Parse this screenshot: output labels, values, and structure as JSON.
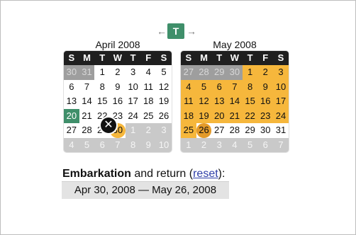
{
  "nav": {
    "left_arrow": "←",
    "today": "T",
    "right_arrow": "→"
  },
  "calendars": [
    {
      "month": "April 2008",
      "weekdays": [
        "S",
        "M",
        "T",
        "W",
        "T",
        "F",
        "S"
      ],
      "weeks": [
        [
          "30",
          "31",
          "1",
          "2",
          "3",
          "4",
          "5"
        ],
        [
          "6",
          "7",
          "8",
          "9",
          "10",
          "11",
          "12"
        ],
        [
          "13",
          "14",
          "15",
          "16",
          "17",
          "18",
          "19"
        ],
        [
          "20",
          "21",
          "22",
          "23",
          "24",
          "25",
          "26"
        ],
        [
          "27",
          "28",
          "29",
          "30",
          "1",
          "2",
          "3"
        ],
        [
          "4",
          "5",
          "6",
          "7",
          "8",
          "9",
          "10"
        ]
      ]
    },
    {
      "month": "May 2008",
      "weekdays": [
        "S",
        "M",
        "T",
        "W",
        "T",
        "F",
        "S"
      ],
      "weeks": [
        [
          "27",
          "28",
          "29",
          "30",
          "1",
          "2",
          "3"
        ],
        [
          "4",
          "5",
          "6",
          "7",
          "8",
          "9",
          "10"
        ],
        [
          "11",
          "12",
          "13",
          "14",
          "15",
          "16",
          "17"
        ],
        [
          "18",
          "19",
          "20",
          "21",
          "22",
          "23",
          "24"
        ],
        [
          "25",
          "26",
          "27",
          "28",
          "29",
          "30",
          "31"
        ],
        [
          "1",
          "2",
          "3",
          "4",
          "5",
          "6",
          "7"
        ]
      ]
    }
  ],
  "labels": {
    "embarkation": "Embarkation",
    "and_return": "and return",
    "open_paren": "(",
    "reset": "reset",
    "close_paren": "):"
  },
  "range": {
    "text": "Apr 30, 2008  —  May 26, 2008"
  },
  "colors": {
    "selected": "#f6b73c",
    "today": "#3f8f6a",
    "header": "#1f1f1f"
  }
}
